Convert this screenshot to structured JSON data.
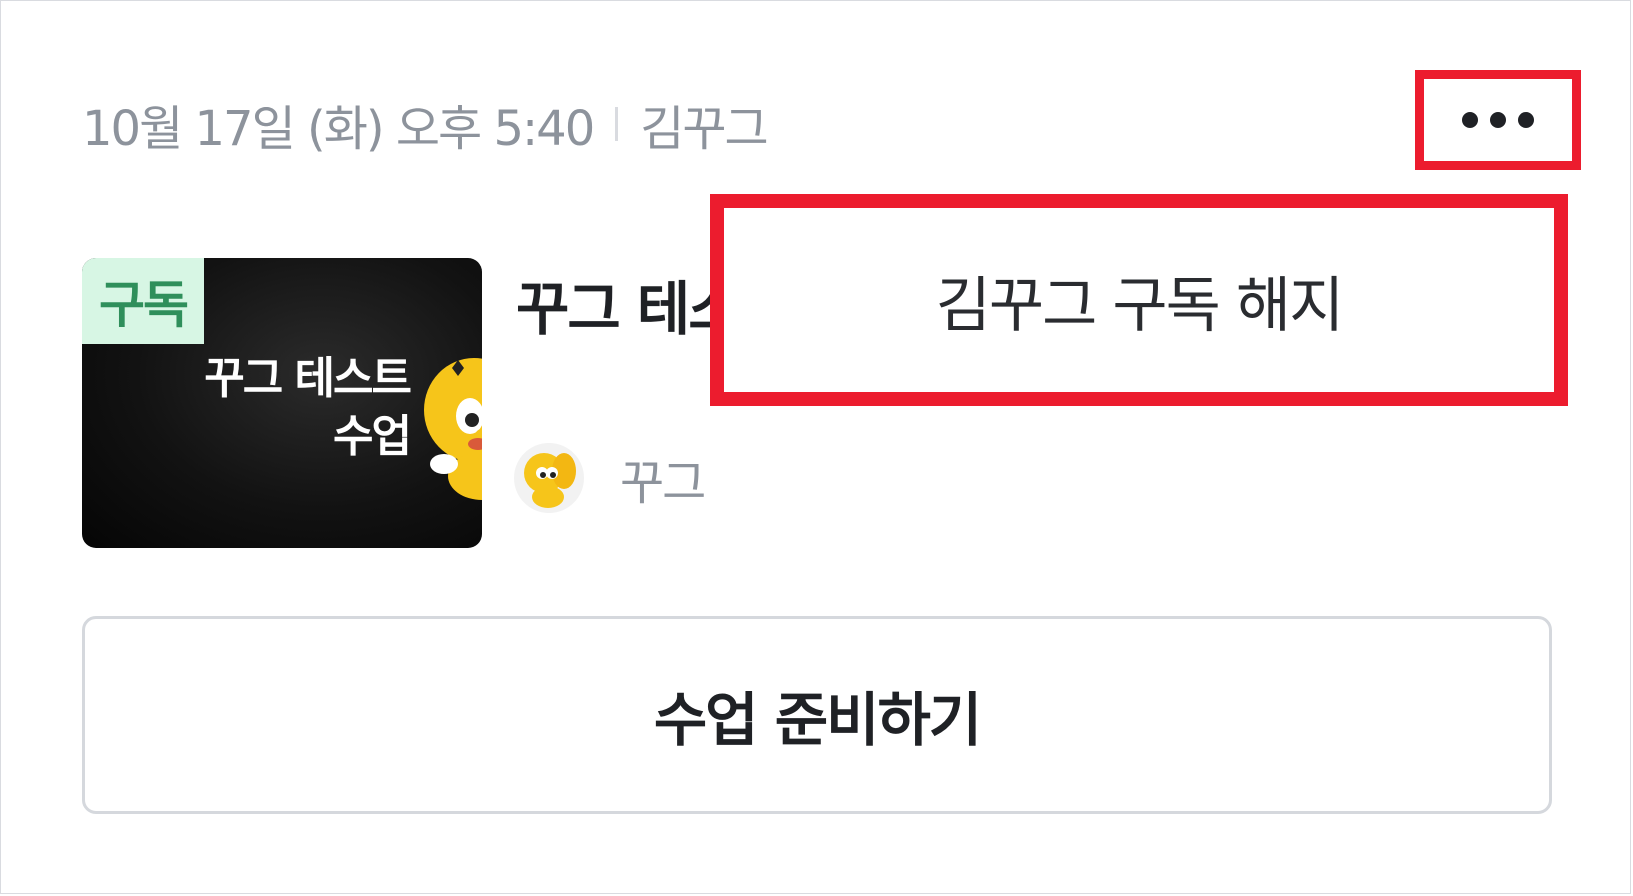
{
  "card": {
    "date": "10월 17일 (화) 오후 5:40",
    "creator": "김꾸그",
    "more_icon": "more-horizontal-icon"
  },
  "thumbnail": {
    "badge": "구독",
    "line1": "꾸그 테스트",
    "line2": "수업",
    "mascot_icon": "elephant-mascot-icon"
  },
  "lesson": {
    "title": "꾸그 테스트 수업",
    "author": "꾸그"
  },
  "popup_menu": {
    "unsubscribe_label": "김꾸그 구독 해지"
  },
  "actions": {
    "prepare_label": "수업 준비하기"
  },
  "colors": {
    "highlight": "#ec1c2e",
    "badge_bg": "#d7f6e4",
    "badge_text": "#2f8f5b",
    "mascot_yellow": "#f6c51a"
  }
}
